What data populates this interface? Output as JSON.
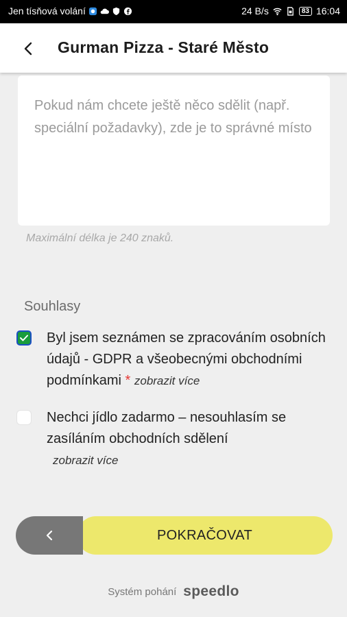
{
  "status_bar": {
    "carrier": "Jen tísňová volání",
    "net_speed": "24 B/s",
    "battery": "83",
    "time": "16:04"
  },
  "app_bar": {
    "title": "Gurman Pizza - Staré Město"
  },
  "note": {
    "value": "",
    "placeholder": "Pokud nám chcete ještě něco sdělit (např. speciální požadavky), zde je to správné místo",
    "hint": "Maximální délka je 240 znaků."
  },
  "consents": {
    "title": "Souhlasy",
    "items": [
      {
        "text": "Byl jsem seznámen se zpracováním osobních údajů - GDPR a všeobecnými obchodními podmínkami",
        "required_mark": "*",
        "more": "zobrazit více",
        "checked": true
      },
      {
        "text": "Nechci jídlo zadarmo – nesouhlasím se zasíláním obchodních sdělení",
        "more": "zobrazit více",
        "checked": false
      }
    ]
  },
  "actions": {
    "continue_label": "POKRAČOVAT"
  },
  "footer": {
    "powered_by": "Systém pohání",
    "brand": "speedlo"
  },
  "colors": {
    "accent_yellow": "#ede86c",
    "back_gray": "#777777",
    "checkbox_green": "#1a9c3c",
    "required_red": "#e53935"
  }
}
